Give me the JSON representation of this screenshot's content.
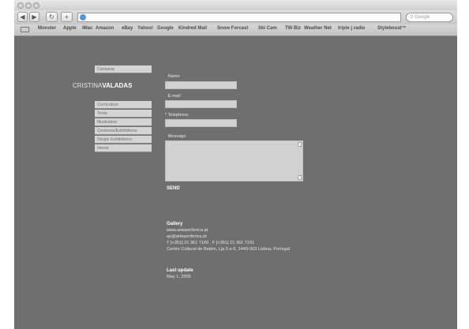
{
  "browser": {
    "address_url": "",
    "search_placeholder": "Google",
    "bookmarks": [
      "Monster",
      "Apple",
      "iMac",
      "Amazon",
      "eBay",
      "Yahoo!",
      "Google",
      "Kindred Mail",
      "Snow Forcast",
      "Ski Cam",
      "TW Biz",
      "Weather Net",
      "triple j radio",
      "Styleboost™"
    ]
  },
  "site": {
    "brand_first": "CRISTINA",
    "brand_last": "VALADAS",
    "contacts_label": "Contacts",
    "menu": [
      "Curriculum",
      "Texts",
      "Illustration",
      "Contests/Exhibitions",
      "Single Exhibitions",
      "Home"
    ]
  },
  "form": {
    "name_label": "Name",
    "email_label": "E-mail",
    "telephone_label": "Telephone",
    "message_label": "Message",
    "required_mark": "*",
    "name_value": "",
    "send_label": "SEND"
  },
  "gallery": {
    "heading": "Gallery",
    "lines": [
      "www.arteperiferica.pt",
      "ap@arteperiferica.pt",
      "T [+351] 21 361 7100 . F [+351] 21 361 7191",
      "Centro Cultural de Belém, Lja 5 e 6, 1449-003 Lisboa, Portugal"
    ]
  },
  "last_update": {
    "heading": "Last update",
    "date": "May 1, 2005"
  }
}
